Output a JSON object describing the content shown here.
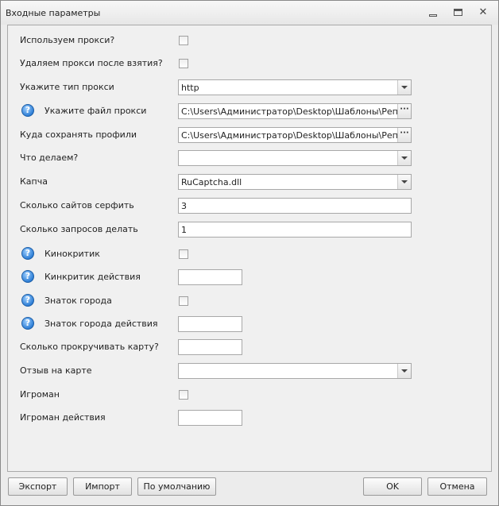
{
  "window": {
    "title": "Входные параметры",
    "minimize_icon": "minimize-icon",
    "maximize_icon": "maximize-icon",
    "close_glyph": "✕"
  },
  "rows": [
    {
      "label": "Используем прокси?",
      "type": "checkbox",
      "checked": false
    },
    {
      "label": "Удаляем прокси после взятия?",
      "type": "checkbox",
      "checked": false
    },
    {
      "label": "Укажите тип прокси",
      "type": "dropdown",
      "value": "http"
    },
    {
      "label": "Укажите файл прокси",
      "type": "file",
      "value": "C:\\Users\\Администратор\\Desktop\\Шаблоны\\Репутация",
      "help": true
    },
    {
      "label": "Куда сохранять профили",
      "type": "file",
      "value": "C:\\Users\\Администратор\\Desktop\\Шаблоны\\Репутация"
    },
    {
      "label": "Что делаем?",
      "type": "dropdown",
      "value": ""
    },
    {
      "label": "Капча",
      "type": "dropdown",
      "value": "RuCaptcha.dll"
    },
    {
      "label": "Сколько сайтов серфить",
      "type": "text",
      "value": "3"
    },
    {
      "label": "Сколько запросов делать",
      "type": "text",
      "value": "1"
    },
    {
      "label": "Кинокритик",
      "type": "checkbox",
      "checked": false,
      "help": true
    },
    {
      "label": "Кинкритик действия",
      "type": "short",
      "value": "",
      "help": true
    },
    {
      "label": "Знаток города",
      "type": "checkbox",
      "checked": false,
      "help": true
    },
    {
      "label": "Знаток города действия",
      "type": "short",
      "value": "",
      "help": true
    },
    {
      "label": "Сколько прокручивать карту?",
      "type": "short",
      "value": ""
    },
    {
      "label": "Отзыв на карте",
      "type": "dropdown",
      "value": ""
    },
    {
      "label": "Игроман",
      "type": "checkbox",
      "checked": false
    },
    {
      "label": "Игроман действия",
      "type": "short",
      "value": ""
    }
  ],
  "help_glyph": "?",
  "browse_glyph": "···",
  "buttons": {
    "export": "Экспорт",
    "import": "Импорт",
    "defaults": "По умолчанию",
    "ok": "OK",
    "cancel": "Отмена"
  }
}
